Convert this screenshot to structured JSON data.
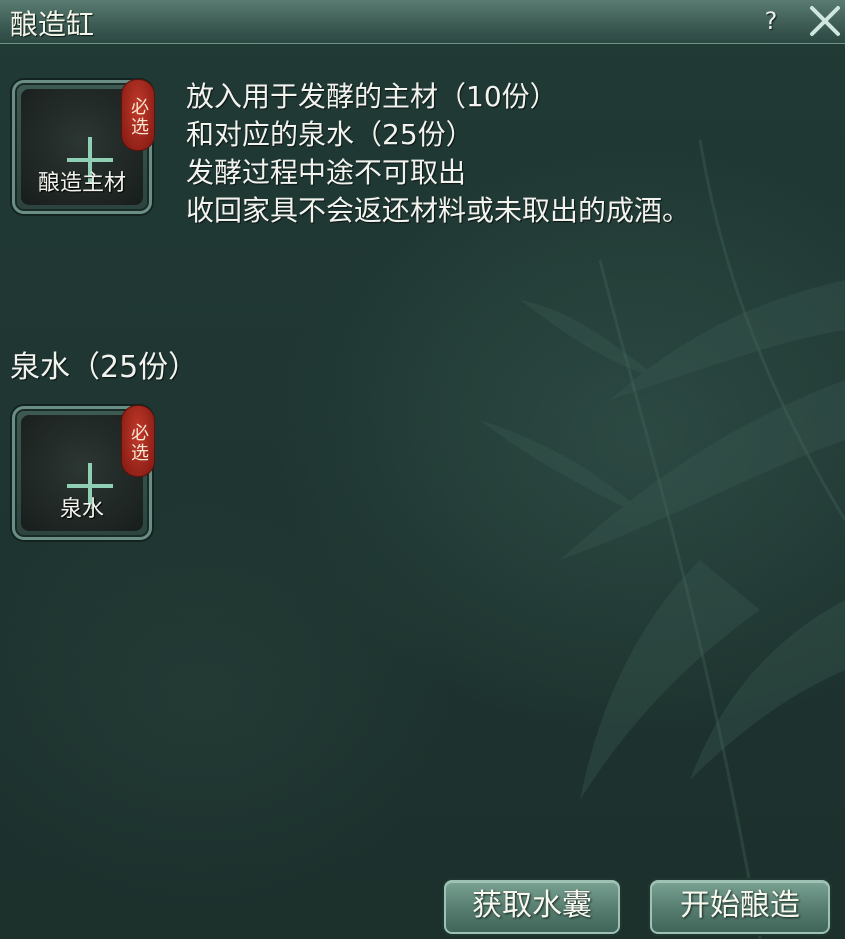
{
  "window": {
    "title": "酿造缸",
    "help_label": "?"
  },
  "main_slot": {
    "label": "酿造主材",
    "badge": "必选"
  },
  "description": [
    "放入用于发酵的主材（10份）",
    "和对应的泉水（25份）",
    "发酵过程中途不可取出",
    "收回家具不会返还材料或未取出的成酒。"
  ],
  "water_section": {
    "title": "泉水（25份）",
    "slot_label": "泉水",
    "badge": "必选"
  },
  "buttons": {
    "get_water": "获取水囊",
    "start_brew": "开始酿造"
  },
  "colors": {
    "background": "#1f3632",
    "badge_red": "#a8271b",
    "button_green": "#557c6f"
  }
}
